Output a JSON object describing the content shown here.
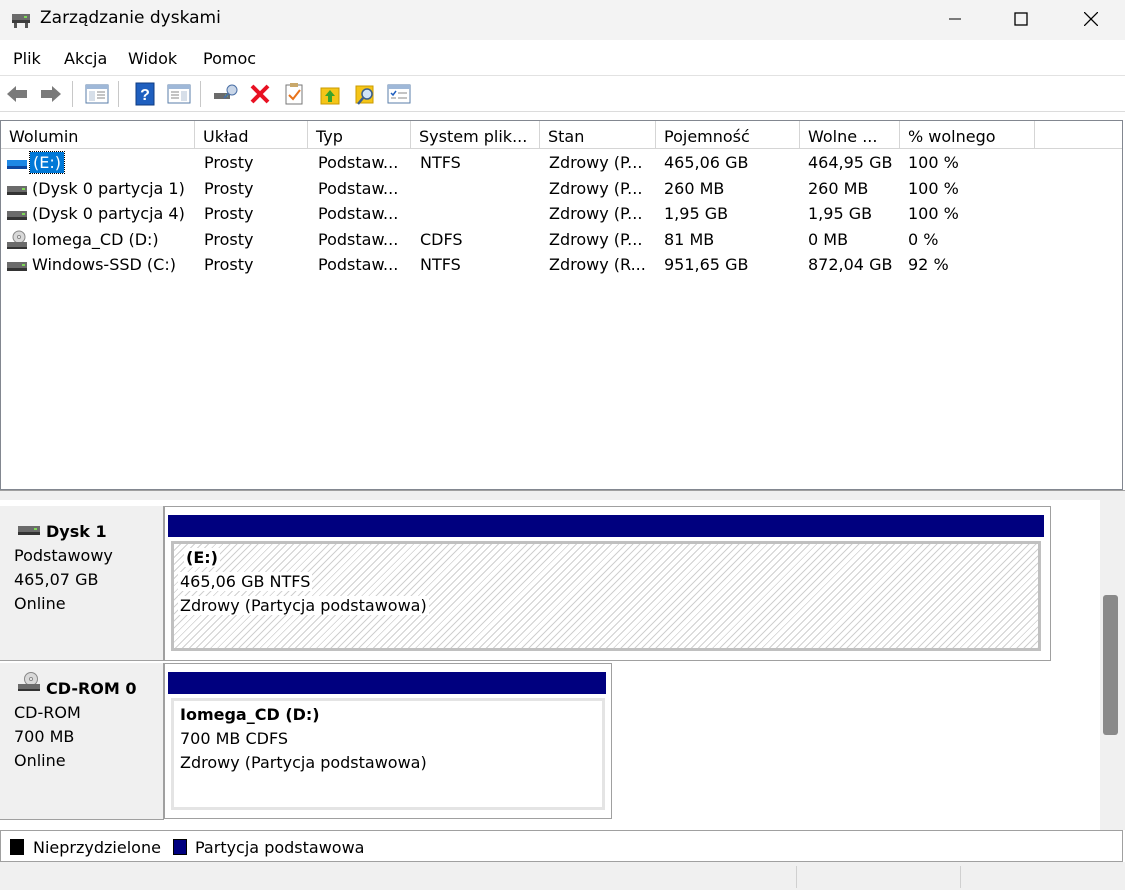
{
  "window": {
    "title": "Zarządzanie dyskami",
    "controls": {
      "minimize": "—",
      "maximize": "☐",
      "close": "✕"
    }
  },
  "menu": [
    "Plik",
    "Akcja",
    "Widok",
    "Pomoc"
  ],
  "toolbar": {
    "buttons": [
      "back-icon",
      "forward-icon",
      "console-tree-icon",
      "help-icon",
      "action-pane-icon",
      "connect-drive-icon",
      "delete-icon",
      "properties-icon",
      "upload-icon",
      "search-icon",
      "list-icon"
    ],
    "colors": {
      "delete": "#e81123",
      "help": "#1f5fbf",
      "folder": "#f5c518"
    }
  },
  "volumes": {
    "columns": [
      "Wolumin",
      "Układ",
      "Typ",
      "System plik...",
      "Stan",
      "Pojemność",
      "Wolne ...",
      "% wolnego"
    ],
    "rows": [
      {
        "icon": "usb-drive-icon",
        "cells": [
          "(E:)",
          "Prosty",
          "Podstaw...",
          "NTFS",
          "Zdrowy (P...",
          "465,06 GB",
          "464,95 GB",
          "100 %"
        ],
        "selected": true
      },
      {
        "icon": "drive-icon",
        "cells": [
          "(Dysk 0 partycja 1)",
          "Prosty",
          "Podstaw...",
          "",
          "Zdrowy (P...",
          "260 MB",
          "260 MB",
          "100 %"
        ],
        "selected": false
      },
      {
        "icon": "drive-icon",
        "cells": [
          "(Dysk 0 partycja 4)",
          "Prosty",
          "Podstaw...",
          "",
          "Zdrowy (P...",
          "1,95 GB",
          "1,95 GB",
          "100 %"
        ],
        "selected": false
      },
      {
        "icon": "cd-drive-icon",
        "cells": [
          "Iomega_CD (D:)",
          "Prosty",
          "Podstaw...",
          "CDFS",
          "Zdrowy (P...",
          "81 MB",
          "0 MB",
          "0 %"
        ],
        "selected": false
      },
      {
        "icon": "drive-icon",
        "cells": [
          "Windows-SSD (C:)",
          "Prosty",
          "Podstaw...",
          "NTFS",
          "Zdrowy (R...",
          "951,65 GB",
          "872,04 GB",
          "92 %"
        ],
        "selected": false
      }
    ]
  },
  "disks": [
    {
      "icon": "drive-icon",
      "name": "Dysk 1",
      "type": "Podstawowy",
      "size": "465,07 GB",
      "status": "Online",
      "partition": {
        "name": "(E:)",
        "detail": "465,06 GB NTFS",
        "status": "Zdrowy (Partycja podstawowa)"
      }
    },
    {
      "icon": "cd-drive-icon",
      "name": "CD-ROM 0",
      "type": "CD-ROM",
      "size": "700 MB",
      "status": "Online",
      "partition": {
        "name": "Iomega_CD  (D:)",
        "detail": "700 MB CDFS",
        "status": "Zdrowy (Partycja podstawowa)"
      }
    }
  ],
  "legend": [
    {
      "label": "Nieprzydzielone",
      "color": "#000000"
    },
    {
      "label": "Partycja podstawowa",
      "color": "#00007f"
    }
  ],
  "colors": {
    "selection": "#0078d7",
    "partition_bar": "#00007f"
  }
}
